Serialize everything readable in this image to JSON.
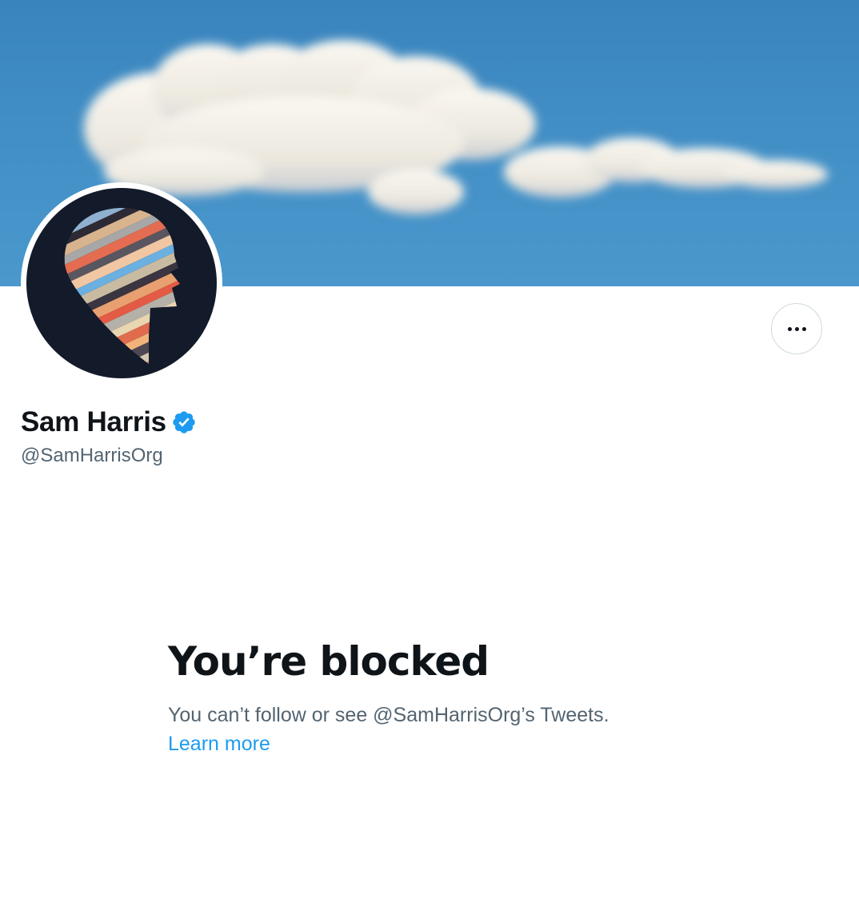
{
  "profile": {
    "display_name": "Sam Harris",
    "verified": true,
    "handle": "@SamHarrisOrg"
  },
  "banner": {
    "description_icon": "sky-cloud-header-image"
  },
  "avatar": {
    "icon": "striped-head-silhouette-avatar"
  },
  "actions": {
    "more_icon": "ellipsis-icon"
  },
  "blocked": {
    "title": "You’re blocked",
    "description": "You can’t follow or see @SamHarrisOrg’s Tweets.",
    "learn_more": "Learn more"
  },
  "colors": {
    "text_primary": "#0f1419",
    "text_secondary": "#536471",
    "link": "#1d9bf0",
    "verified": "#1d9bf0",
    "banner_sky": "#4390c7",
    "avatar_background": "#131a2a"
  }
}
